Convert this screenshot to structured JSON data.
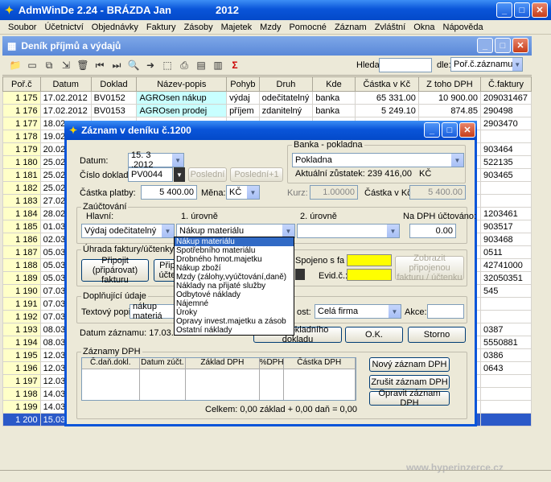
{
  "app": {
    "title": "AdmWinDe 2.24 - BRÁZDA Jan",
    "year": "2012"
  },
  "menu": [
    "Soubor",
    "Účetnictví",
    "Objednávky",
    "Faktury",
    "Zásoby",
    "Majetek",
    "Mzdy",
    "Pomocné",
    "Záznam",
    "Zvláštní",
    "Okna",
    "Nápověda"
  ],
  "child": {
    "title": "Deník příjmů a výdajů"
  },
  "search": {
    "label": "Hledat:",
    "value": "",
    "by_label": "dle:",
    "by_value": "Poř.č.záznamu"
  },
  "table": {
    "columns": [
      "Poř.č",
      "Datum",
      "Doklad",
      "Název-popis",
      "Pohyb",
      "Druh",
      "Kde",
      "Částka v Kč",
      "Z toho DPH",
      "Č.faktury"
    ],
    "rows": [
      [
        "1 175",
        "17.02.2012",
        "BV0152",
        "AGROsen nákup",
        "výdaj",
        "odečitatelný",
        "banka",
        "65 331.00",
        "10 900.00",
        "209031467"
      ],
      [
        "1 176",
        "17.02.2012",
        "BV0153",
        "AGROsen prodej",
        "příjem",
        "zdanitelný",
        "banka",
        "5 249.10",
        "874.85",
        "290498"
      ],
      [
        "1 177",
        "18.02",
        "",
        "",
        "",
        "",
        "",
        "",
        "",
        "2903470"
      ],
      [
        "1 178",
        "19.02",
        "",
        "",
        "",
        "",
        "",
        "",
        "",
        ""
      ],
      [
        "1 179",
        "20.02",
        "",
        "",
        "",
        "",
        "",
        "",
        "",
        "903464"
      ],
      [
        "1 180",
        "25.02",
        "",
        "",
        "",
        "",
        "",
        "",
        "",
        "522135"
      ],
      [
        "1 181",
        "25.02",
        "",
        "",
        "",
        "",
        "",
        "",
        "",
        "903465"
      ],
      [
        "1 182",
        "25.02",
        "",
        "",
        "",
        "",
        "",
        "",
        "",
        ""
      ],
      [
        "1 183",
        "27.02",
        "",
        "",
        "",
        "",
        "",
        "",
        "",
        ""
      ],
      [
        "1 184",
        "28.02",
        "",
        "",
        "",
        "",
        "",
        "",
        "",
        "1203461"
      ],
      [
        "1 185",
        "01.03",
        "",
        "",
        "",
        "",
        "",
        "",
        "",
        "903517"
      ],
      [
        "1 186",
        "02.03",
        "",
        "",
        "",
        "",
        "",
        "",
        "",
        "903468"
      ],
      [
        "1 187",
        "05.03",
        "",
        "",
        "",
        "",
        "",
        "",
        "",
        "0511"
      ],
      [
        "1 188",
        "05.03",
        "",
        "",
        "",
        "",
        "",
        "",
        "",
        "42741000"
      ],
      [
        "1 189",
        "05.03",
        "",
        "",
        "",
        "",
        "",
        "",
        "",
        "32050351"
      ],
      [
        "1 190",
        "07.03",
        "",
        "",
        "",
        "",
        "",
        "",
        "",
        "545"
      ],
      [
        "1 191",
        "07.03",
        "",
        "",
        "",
        "",
        "",
        "",
        "",
        ""
      ],
      [
        "1 192",
        "07.03",
        "",
        "",
        "",
        "",
        "",
        "",
        "",
        ""
      ],
      [
        "1 193",
        "08.03",
        "",
        "",
        "",
        "",
        "",
        "",
        "",
        "0387"
      ],
      [
        "1 194",
        "08.03",
        "",
        "",
        "",
        "",
        "",
        "",
        "",
        "5550881"
      ],
      [
        "1 195",
        "12.03",
        "",
        "",
        "",
        "",
        "",
        "",
        "",
        "0386"
      ],
      [
        "1 196",
        "12.03",
        "",
        "",
        "",
        "",
        "",
        "",
        "",
        "0643"
      ],
      [
        "1 197",
        "12.03",
        "",
        "",
        "",
        "",
        "",
        "",
        "",
        ""
      ],
      [
        "1 198",
        "14.03",
        "",
        "",
        "",
        "",
        "",
        "",
        "",
        ""
      ],
      [
        "1 199",
        "14.03",
        "",
        "",
        "",
        "",
        "",
        "",
        "",
        ""
      ],
      [
        "1 200",
        "15.03.2012",
        "PV0044",
        "nákup materiálu",
        "výdaj",
        "odečitatelný",
        "pokladna",
        "5 400.00",
        "",
        ""
      ]
    ]
  },
  "dialog": {
    "title": "Záznam v deníku č.1200",
    "datum_label": "Datum:",
    "datum": "15. 3 .2012",
    "cislo_label": "Číslo dokladu:",
    "cislo": "PV0044",
    "posledni": "Poslední",
    "posledni1": "Poslední+1",
    "castka_label": "Částka platby:",
    "castka": "5 400.00",
    "mena_label": "Měna:",
    "mena": "KČ",
    "kurz_label": "Kurz:",
    "kurz": "1.00000",
    "castka_kc_label": "Částka v Kč:",
    "castka_kc": "5 400.00",
    "banka_label": "Banka - pokladna",
    "banka": "Pokladna",
    "zustatek": "Aktuální zůstatek: 239 416,00",
    "zustatek_mena": "KČ",
    "zauct_label": "Zaúčtování",
    "hlavni_label": "Hlavní:",
    "hlavni": "Výdaj odečitatelný",
    "uroven1_label": "1. úrovně",
    "uroven1": "Nákup materiálu",
    "uroven2_label": "2. úrovně",
    "nadph_label": "Na DPH účtováno:",
    "nadph": "0.00",
    "dropdown": [
      "Nákup materiálu",
      "Spotřebního materiálu",
      "Drobného hmot.majetku",
      "Nákup zboží",
      "Mzdy (zálohy,vyúčtování,daně)",
      "Náklady na přijaté služby",
      "Odbytové náklady",
      "Nájemné",
      "Úroky",
      "Opravy invest.majetku a zásob",
      "Ostatní náklady"
    ],
    "uhrada_label": "Úhrada faktury/účtenky (vazb",
    "pripojit": "Připojit (připárovat) fakturu",
    "pripojit2": "Připo účten",
    "spojeno_label": "Spojeno s fa č.:",
    "evid_label": "Evid.č.:",
    "zobrazit": "Zobrazit připojenou fakturu / účtenku",
    "doplnujici_label": "Doplňující údaje",
    "textovy_label": "Textový popis:",
    "textovy": "nákup materiá",
    "ost_label": "ost:",
    "ost": "Celá firma",
    "akce_label": "Akce:",
    "datum_zaznamu": "Datum záznamu: 17.03.2012",
    "pokladni": "Tisk pokladního dokladu",
    "ok": "O.K.",
    "storno": "Storno",
    "dph_label": "Záznamy DPH",
    "dph_cols": [
      "Č.daň.dokl.",
      "Datum zúčt.",
      "Základ DPH",
      "%DPH",
      "Částka DPH"
    ],
    "novy": "Nový záznam DPH",
    "zrusit": "Zrušit záznam DPH",
    "opravit": "Opravit záznam DPH",
    "celkem": "Celkem:  0,00  základ  +  0,00  daň  =  0,00"
  },
  "watermark": "www.hyperinzerce.cz"
}
